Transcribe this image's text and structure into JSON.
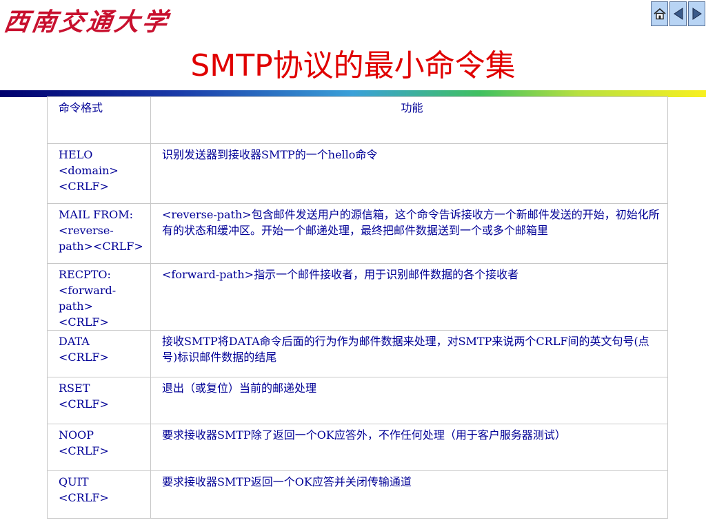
{
  "header": {
    "logo_text": "西南交通大学",
    "title": "SMTP协议的最小命令集",
    "nav": [
      {
        "icon": "home-icon"
      },
      {
        "icon": "prev-arrow-icon"
      },
      {
        "icon": "next-arrow-icon"
      }
    ]
  },
  "colors": {
    "title": "#e00000",
    "table_text": "#000096",
    "logo": "#c8102e",
    "nav_bg": "#b8d4f4"
  },
  "table": {
    "headers": [
      "命令格式",
      "功能"
    ],
    "rows": [
      {
        "command": "HELO\n<domain>\n<CRLF>",
        "function": "识别发送器到接收器SMTP的一个hello命令"
      },
      {
        "command": "MAIL FROM:\n<reverse-\npath><CRLF>",
        "function": "<reverse-path>包含邮件发送用户的源信箱，这个命令告诉接收方一个新邮件发送的开始，初始化所有的状态和缓冲区。开始一个邮递处理，最终把邮件数据送到一个或多个邮箱里"
      },
      {
        "command": "RECPTO:\n<forward-\npath>\n<CRLF>",
        "function": "<forward-path>指示一个邮件接收者，用于识别邮件数据的各个接收者"
      },
      {
        "command": "DATA\n<CRLF>",
        "function": "接收SMTP将DATA命令后面的行为作为邮件数据来处理，对SMTP来说两个CRLF间的英文句号(点号)标识邮件数据的结尾"
      },
      {
        "command": "RSET\n<CRLF>",
        "function": "退出（或复位）当前的邮递处理"
      },
      {
        "command": "NOOP\n<CRLF>",
        "function": "要求接收器SMTP除了返回一个OK应答外，不作任何处理（用于客户服务器测试）"
      },
      {
        "command": "QUIT\n<CRLF>",
        "function": "要求接收器SMTP返回一个OK应答并关闭传输通道"
      }
    ]
  }
}
